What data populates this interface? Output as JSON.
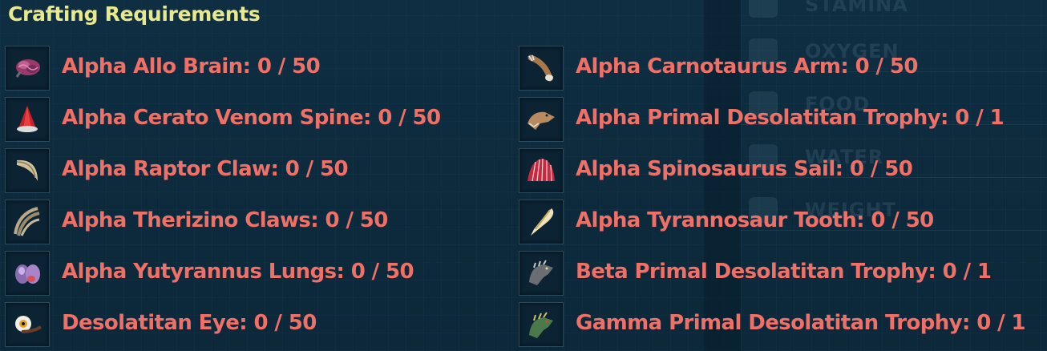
{
  "title": "Crafting Requirements",
  "requirements": [
    {
      "text": "Alpha Allo Brain: 0 / 50",
      "icon": "brain-icon"
    },
    {
      "text": "Alpha Cerato Venom Spine: 0 / 50",
      "icon": "venom-spine-icon"
    },
    {
      "text": "Alpha Raptor Claw: 0 / 50",
      "icon": "raptor-claw-icon"
    },
    {
      "text": "Alpha Therizino Claws: 0 / 50",
      "icon": "therizino-claws-icon"
    },
    {
      "text": "Alpha Yutyrannus Lungs: 0 / 50",
      "icon": "lungs-icon"
    },
    {
      "text": "Desolatitan Eye: 0 / 50",
      "icon": "eye-icon"
    },
    {
      "text": "Alpha Carnotaurus Arm: 0 / 50",
      "icon": "carnotaurus-arm-icon"
    },
    {
      "text": "Alpha Primal Desolatitan Trophy: 0 / 1",
      "icon": "alpha-trophy-icon"
    },
    {
      "text": "Alpha Spinosaurus Sail: 0 / 50",
      "icon": "spinosaurus-sail-icon"
    },
    {
      "text": "Alpha Tyrannosaur Tooth: 0 / 50",
      "icon": "tooth-icon"
    },
    {
      "text": "Beta Primal Desolatitan Trophy: 0 / 1",
      "icon": "beta-trophy-icon"
    },
    {
      "text": "Gamma Primal Desolatitan Trophy: 0 / 1",
      "icon": "gamma-trophy-icon"
    }
  ],
  "background_stats": {
    "labels": [
      "STAMINA",
      "OXYGEN",
      "FOOD",
      "WATER",
      "WEIGHT"
    ]
  },
  "colors": {
    "title": "#e8e88c",
    "requirement_text": "#ef7066",
    "background": "#0d2a3c"
  }
}
